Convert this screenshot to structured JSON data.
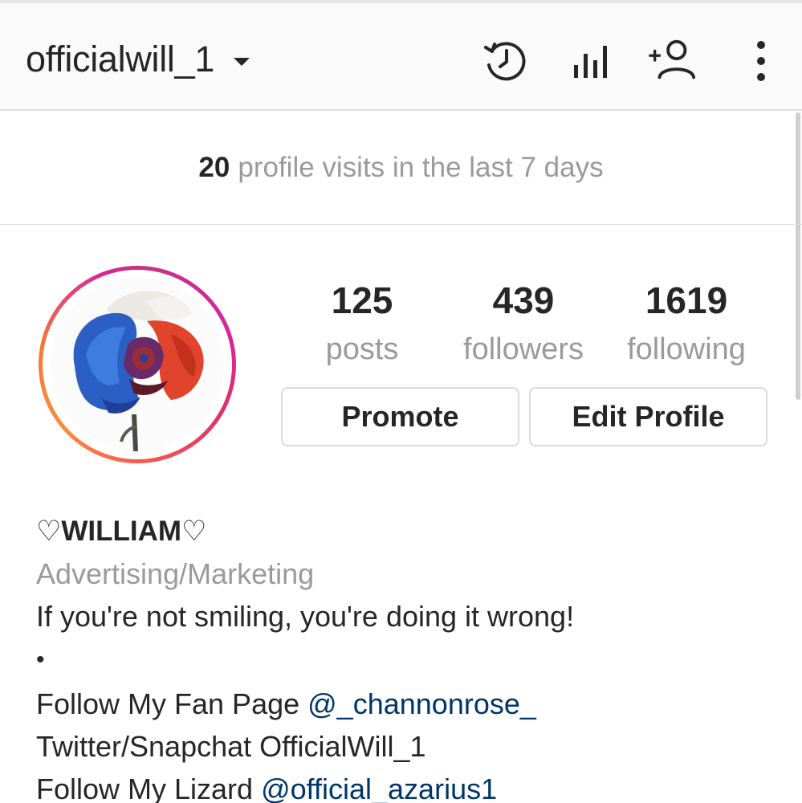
{
  "header": {
    "username": "officialwill_1",
    "icons": {
      "archive": "archive-history-icon",
      "insights": "insights-bar-chart-icon",
      "discover": "add-person-icon",
      "menu": "more-vertical-icon"
    }
  },
  "visits": {
    "count": "20",
    "text": "profile visits in the last 7 days"
  },
  "stats": {
    "posts": {
      "value": "125",
      "label": "posts"
    },
    "followers": {
      "value": "439",
      "label": "followers"
    },
    "following": {
      "value": "1619",
      "label": "following"
    }
  },
  "buttons": {
    "promote": "Promote",
    "edit_profile": "Edit Profile"
  },
  "bio": {
    "name": "♡WILLIAM♡",
    "category": "Advertising/Marketing",
    "tagline": "If you're not smiling, you're doing it wrong!",
    "bullet": "•",
    "fan_page_prefix": "Follow My Fan Page ",
    "fan_page_mention": "@_channonrose_",
    "twitter_line": "Twitter/Snapchat OfficialWill_1",
    "lizard_prefix": "Follow My Lizard ",
    "lizard_mention": "@official_azarius1"
  },
  "colors": {
    "text": "#262626",
    "muted": "#9a9a9a",
    "mention": "#003569",
    "story_ring_start": "#c13584",
    "story_ring_end": "#f77737"
  }
}
